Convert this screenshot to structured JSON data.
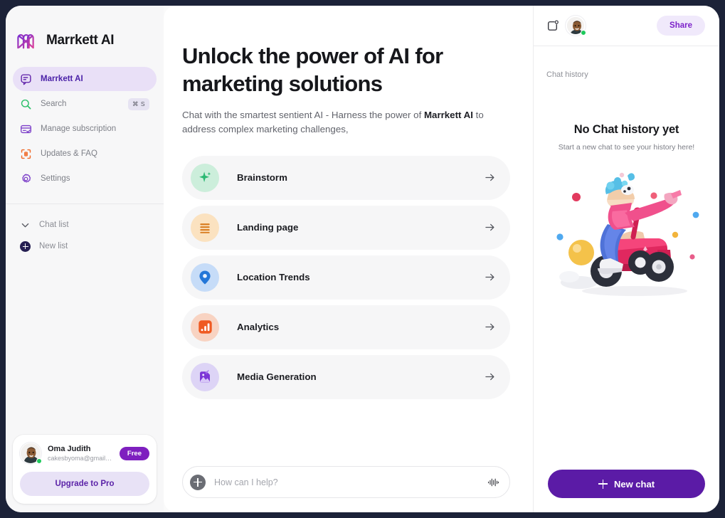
{
  "brand": {
    "name": "Marrkett AI",
    "logo_icon": "marrkett-logo-icon"
  },
  "sidebar": {
    "nav": [
      {
        "label": "Marrkett AI",
        "icon": "chat-bubble-icon",
        "active": true,
        "kbd": ""
      },
      {
        "label": "Search",
        "icon": "search-icon",
        "active": false,
        "kbd": "⌘ S"
      },
      {
        "label": "Manage subscription",
        "icon": "credit-card-check-icon",
        "active": false,
        "kbd": ""
      },
      {
        "label": "Updates & FAQ",
        "icon": "scan-frame-icon",
        "active": false,
        "kbd": ""
      },
      {
        "label": "Settings",
        "icon": "gear-icon",
        "active": false,
        "kbd": ""
      }
    ],
    "groups": [
      {
        "label": "Chat list",
        "icon": "chevron-down-icon"
      },
      {
        "label": "New list",
        "icon": "plus-circle-icon"
      }
    ],
    "user": {
      "name": "Oma Judith",
      "email": "cakesbyoma@gmail.com",
      "plan_badge": "Free",
      "upgrade_label": "Upgrade to Pro",
      "status": "online"
    }
  },
  "main": {
    "headline": "Unlock the power of AI for marketing solutions",
    "subhead_part1": "Chat with the smartest sentient AI - Harness the power of ",
    "subhead_brand": "Marrkett AI",
    "subhead_part2": " to address complex marketing challenges,",
    "cards": [
      {
        "label": "Brainstorm",
        "icon": "sparkle-icon",
        "bg": "#cceedb",
        "fg": "#2bb872"
      },
      {
        "label": "Landing page",
        "icon": "lines-icon",
        "bg": "#fbe2c0",
        "fg": "#d97d21"
      },
      {
        "label": "Location Trends",
        "icon": "map-pin-icon",
        "bg": "#c6dcf8",
        "fg": "#2477d8"
      },
      {
        "label": "Analytics",
        "icon": "bar-chart-icon",
        "bg": "#f8d3c2",
        "fg": "#ef5a22"
      },
      {
        "label": "Media Generation",
        "icon": "image-sparkle-icon",
        "bg": "#ddd4f6",
        "fg": "#7b35d6"
      }
    ],
    "composer": {
      "placeholder": "How can I help?",
      "value": "",
      "add_icon": "plus-circle-icon",
      "voice_icon": "waveform-icon"
    }
  },
  "right_panel": {
    "notification_icon": "notification-square-icon",
    "avatar_status": "online",
    "share_label": "Share",
    "chat_history_label": "Chat history",
    "empty_title": "No Chat history yet",
    "empty_subtitle": "Start a new chat to see your history here!",
    "illustration": "person-riding-pink-scooter-3d-illustration",
    "new_chat_label": "New chat"
  },
  "colors": {
    "accent_purple": "#5b1ba6",
    "accent_purple_light": "#e9e0f7",
    "brand_badge": "#7e1fbf",
    "share_text": "#7c22c9",
    "page_bg": "#1c2238",
    "panel_bg": "#ffffff",
    "sidebar_bg": "#f7f7f8",
    "card_bg": "#f6f6f7",
    "online_green": "#1ec95c"
  }
}
